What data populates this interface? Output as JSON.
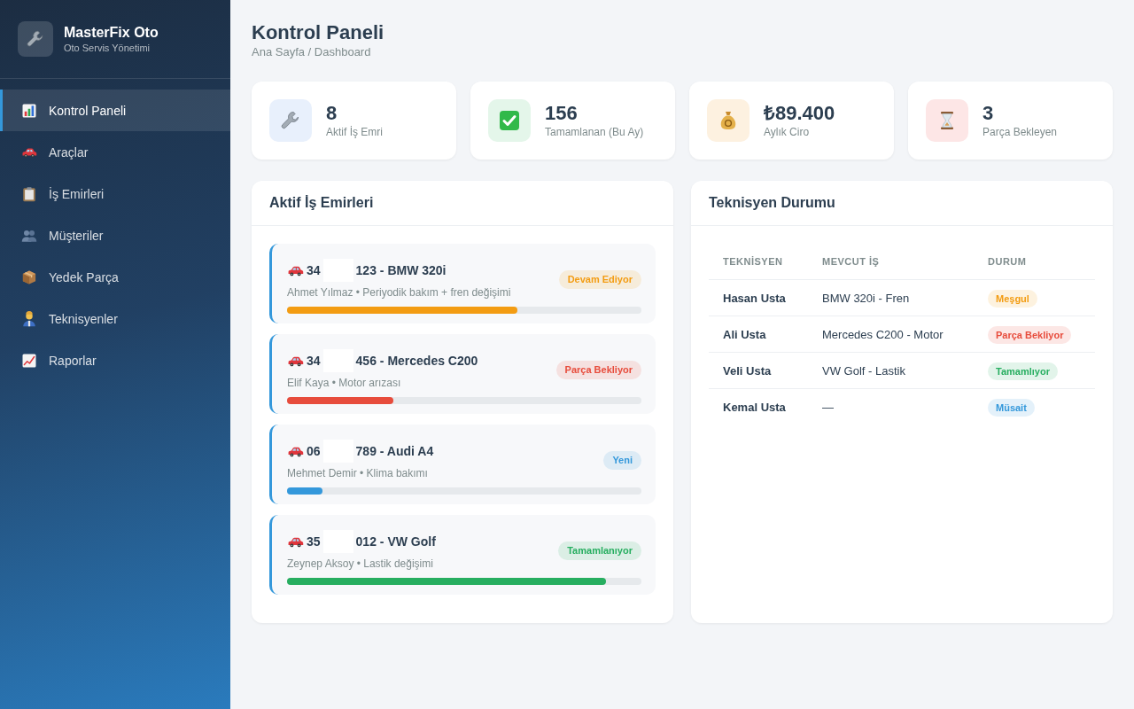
{
  "sidebar": {
    "brand": {
      "title": "MasterFix Oto",
      "subtitle": "Oto Servis Yönetimi"
    },
    "items": [
      {
        "label": "Kontrol Paneli",
        "selected": true
      },
      {
        "label": "Araçlar",
        "selected": false
      },
      {
        "label": "İş Emirleri",
        "selected": false
      },
      {
        "label": "Müşteriler",
        "selected": false
      },
      {
        "label": "Yedek Parça",
        "selected": false
      },
      {
        "label": "Teknisyenler",
        "selected": false
      },
      {
        "label": "Raporlar",
        "selected": false
      }
    ]
  },
  "header": {
    "title": "Kontrol Paneli",
    "breadcrumb": "Ana Sayfa / Dashboard"
  },
  "stats": [
    {
      "value": "8",
      "label": "Aktif İş Emri"
    },
    {
      "value": "156",
      "label": "Tamamlanan (Bu Ay)"
    },
    {
      "value": "₺89.400",
      "label": "Aylık Ciro"
    },
    {
      "value": "3",
      "label": "Parça Bekleyen"
    }
  ],
  "work_orders": {
    "title": "Aktif İş Emirleri",
    "items": [
      {
        "title_start": "34",
        "title_end": "123 - BMW 320i",
        "details": "Ahmet Yılmaz • Periyodik bakım + fren değişimi",
        "status": "Devam Ediyor",
        "color": "#f39c12",
        "level": 0.65
      },
      {
        "title_start": "34",
        "title_end": "456 - Mercedes C200",
        "details": "Elif Kaya • Motor arızası",
        "status": "Parça Bekliyor",
        "color": "#e74c3c",
        "level": 0.3
      },
      {
        "title_start": "06",
        "title_end": "789 - Audi A4",
        "details": "Mehmet Demir • Klima bakımı",
        "status": "Yeni",
        "color": "#3498db",
        "level": 0.1
      },
      {
        "title_start": "35",
        "title_end": "012 - VW Golf",
        "details": "Zeynep Aksoy • Lastik değişimi",
        "status": "Tamamlanıyor",
        "color": "#27ae60",
        "level": 0.9
      }
    ]
  },
  "technicians": {
    "title": "Teknisyen Durumu",
    "columns": [
      "TEKNİSYEN",
      "MEVCUT İŞ",
      "DURUM"
    ],
    "rows": [
      {
        "name": "Hasan Usta",
        "job": "BMW 320i - Fren",
        "status": "Meşgul",
        "color": "#f39c12"
      },
      {
        "name": "Ali Usta",
        "job": "Mercedes C200 - Motor",
        "status": "Parça Bekliyor",
        "color": "#e74c3c"
      },
      {
        "name": "Veli Usta",
        "job": "VW Golf - Lastik",
        "status": "Tamamlıyor",
        "color": "#27ae60"
      },
      {
        "name": "Kemal Usta",
        "job": "—",
        "status": "Müsait",
        "color": "#3498db"
      }
    ]
  }
}
